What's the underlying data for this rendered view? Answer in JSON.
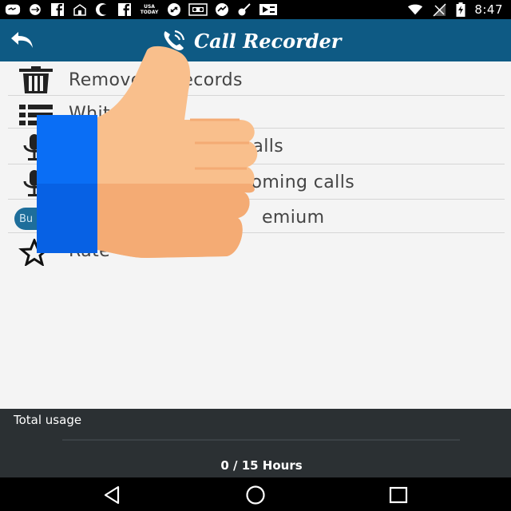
{
  "status_bar": {
    "time": "8:47",
    "notification_icons": [
      "messenger-icon",
      "usb-icon",
      "facebook-icon",
      "usa-today-icon",
      "moon-icon",
      "facebook-icon",
      "usa-today-icon",
      "link-icon",
      "voicemail-icon",
      "sync-icon",
      "guitar-icon",
      "media-icon"
    ],
    "usa_today_text": "USA TODAY",
    "system_icons": [
      "wifi-icon",
      "signal-icon",
      "battery-charging-icon"
    ]
  },
  "app_bar": {
    "title": "Call Recorder",
    "back_icon": "back-arrow-icon",
    "title_icon": "phone-icon",
    "color": "#0e5a84"
  },
  "menu": {
    "items": [
      {
        "label": "Remove all records",
        "icon": "trash-icon"
      },
      {
        "label": "White",
        "icon": "list-icon"
      },
      {
        "label": "going calls",
        "icon": "microphone-icon"
      },
      {
        "label": "coming calls",
        "icon": "microphone-icon"
      },
      {
        "label": "emium",
        "icon": "buy-badge",
        "badge_text": "Bu"
      },
      {
        "label": "Rate",
        "icon": "star-outline-icon"
      }
    ]
  },
  "overlay": {
    "type": "thumbs-up-tutorial",
    "icon": "thumbs-up-icon"
  },
  "usage": {
    "title": "Total usage",
    "value_text": "0 / 15 Hours",
    "progress": 0,
    "accent": "#58c1ef"
  },
  "nav_bar": {
    "back": "nav-back-icon",
    "home": "nav-home-icon",
    "recents": "nav-recents-icon"
  }
}
